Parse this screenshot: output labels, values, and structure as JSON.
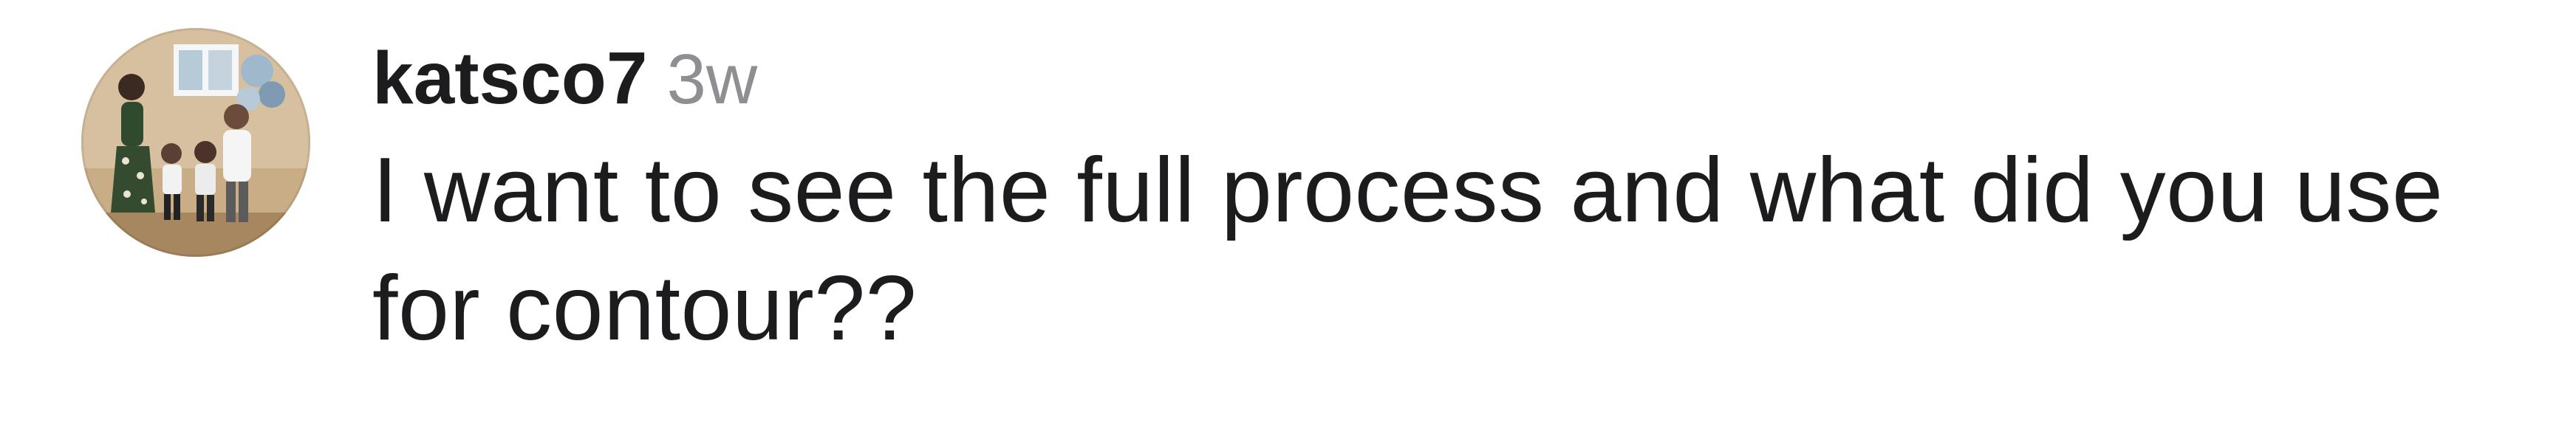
{
  "comment": {
    "username": "katsco7",
    "timestamp": "3w",
    "text": "I want to see the full process and what did you use for contour??",
    "avatar_icon": "user-avatar-photo-icon"
  }
}
